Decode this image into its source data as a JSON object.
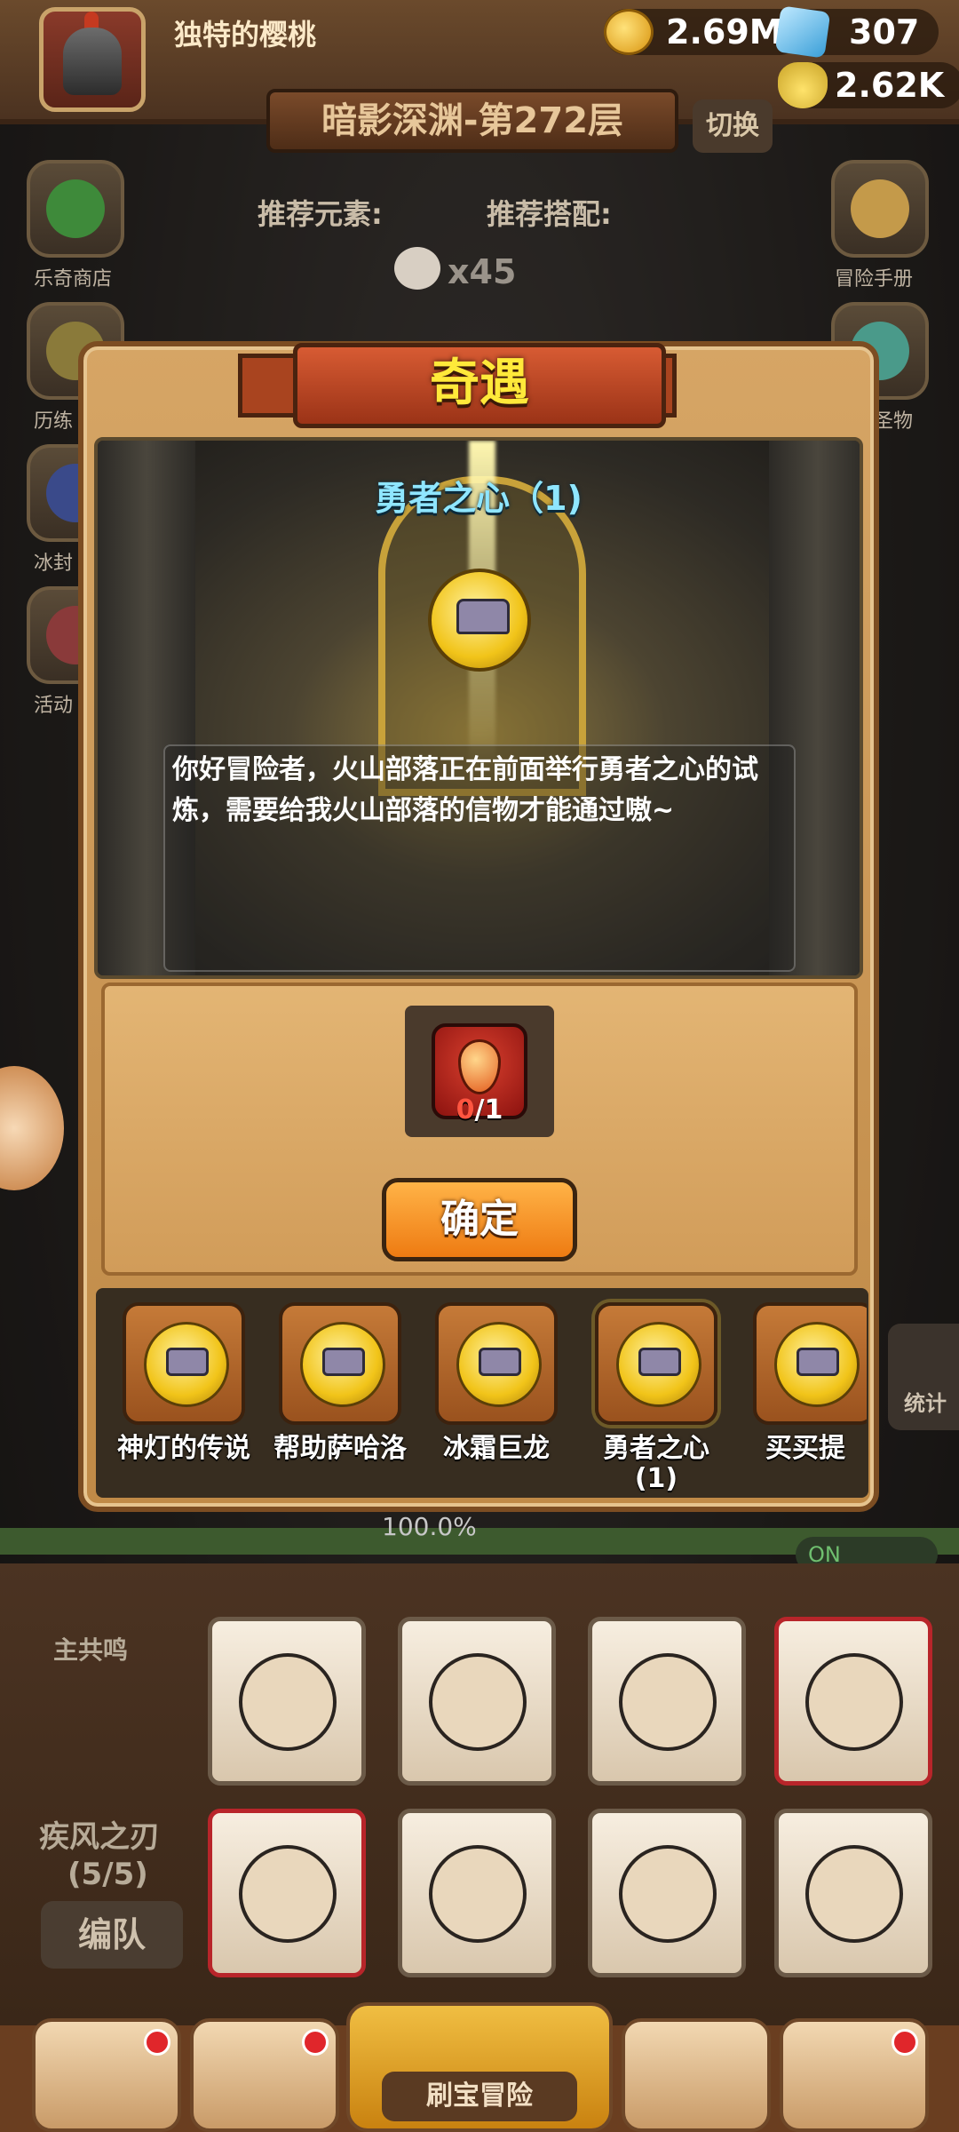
{
  "player": {
    "name": "独特的樱桃"
  },
  "resources": {
    "gold": "2.69M",
    "gems": "307",
    "potion": "2.62K"
  },
  "stage": {
    "title": "暗影深渊-第272层",
    "switch_label": "切换",
    "recommended_elements": "推荐元素:",
    "recommended_combo": "推荐搭配:",
    "skull_count": "x45"
  },
  "side_left": [
    "乐奇商店",
    "历练",
    "冰封",
    "活动"
  ],
  "side_right": [
    "冒险手册",
    "圣物"
  ],
  "dialog": {
    "title": "奇遇",
    "event_name": "勇者之心（1)",
    "text": "你好冒险者，火山部落正在前面举行勇者之心的试炼，需要给我火山部落的信物才能通过嗷~",
    "requirement": {
      "current": "0",
      "total": "/1"
    },
    "confirm_label": "确定",
    "tabs": [
      {
        "label": "神灯的传说"
      },
      {
        "label": "帮助萨哈洛"
      },
      {
        "label": "冰霜巨龙"
      },
      {
        "label": "勇者之心\n(1)"
      },
      {
        "label": "买买提"
      }
    ]
  },
  "progress": {
    "text": "100.0%",
    "toggle": "ON"
  },
  "team": {
    "resonance": "主共鸣",
    "weapon_name": "疾风之刃",
    "weapon_level": "(5/5)",
    "edit_label": "编队"
  },
  "stats_label": "统计",
  "nav": {
    "main_label": "刷宝冒险"
  }
}
